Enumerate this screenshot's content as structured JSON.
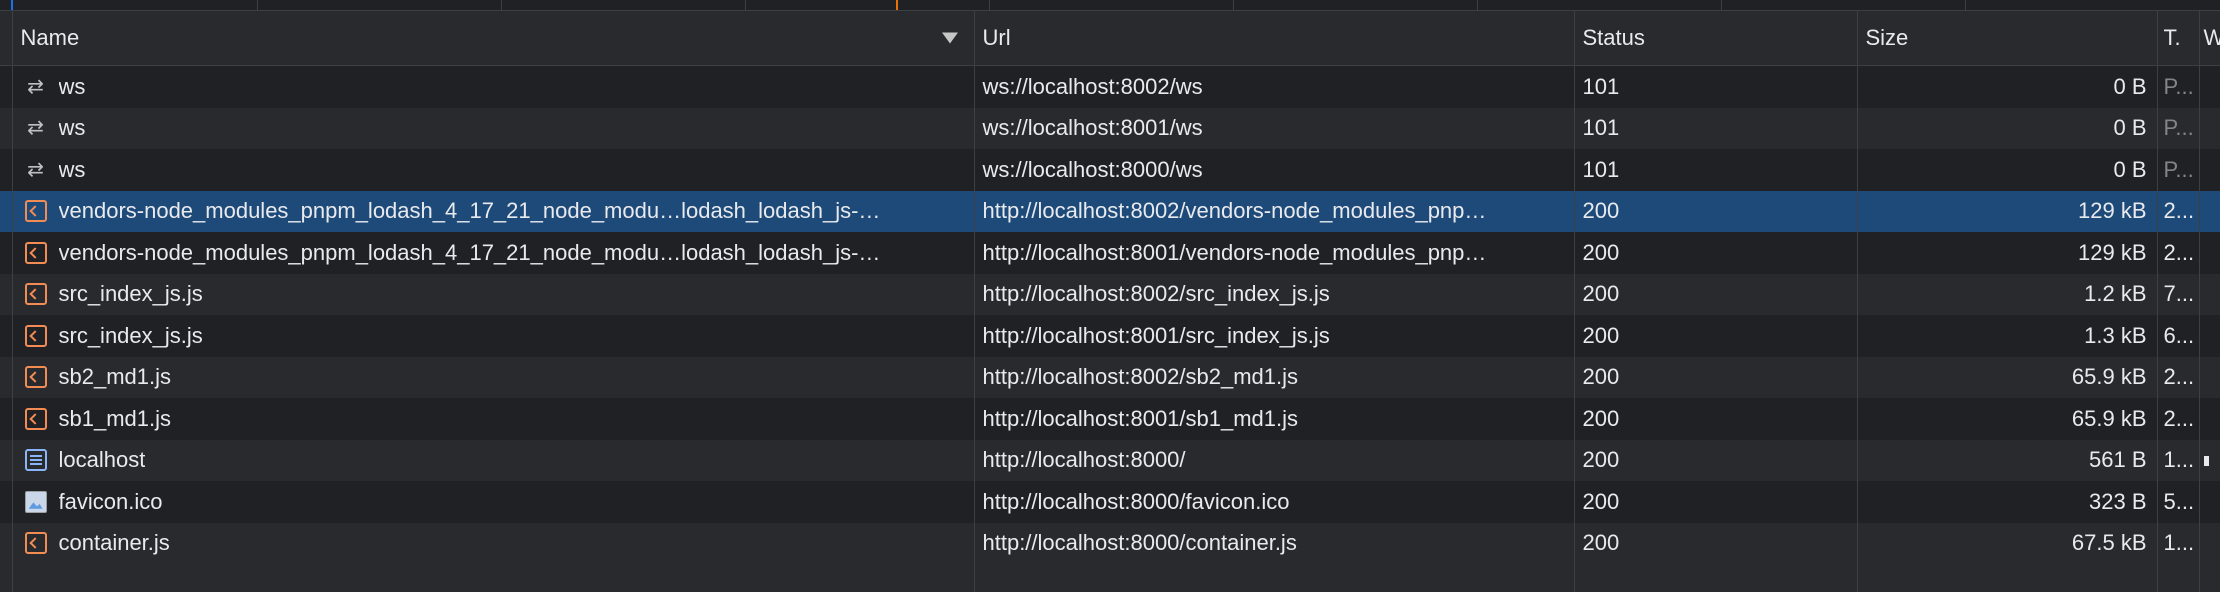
{
  "columns": {
    "name": "Name",
    "url": "Url",
    "status": "Status",
    "size": "Size",
    "type": "T.",
    "waterfall": "W"
  },
  "rows": [
    {
      "icon": "websocket-icon",
      "name": "ws",
      "url": "ws://localhost:8002/ws",
      "status": "101",
      "size": "0 B",
      "type": "P...",
      "type_dim": true
    },
    {
      "icon": "websocket-icon",
      "name": "ws",
      "url": "ws://localhost:8001/ws",
      "status": "101",
      "size": "0 B",
      "type": "P...",
      "type_dim": true
    },
    {
      "icon": "websocket-icon",
      "name": "ws",
      "url": "ws://localhost:8000/ws",
      "status": "101",
      "size": "0 B",
      "type": "P...",
      "type_dim": true
    },
    {
      "icon": "script-icon",
      "name": "vendors-node_modules_pnpm_lodash_4_17_21_node_modu…lodash_lodash_js-…",
      "url": "http://localhost:8002/vendors-node_modules_pnp…",
      "status": "200",
      "size": "129 kB",
      "type": "2...",
      "selected": true
    },
    {
      "icon": "script-icon",
      "name": "vendors-node_modules_pnpm_lodash_4_17_21_node_modu…lodash_lodash_js-…",
      "url": "http://localhost:8001/vendors-node_modules_pnp…",
      "status": "200",
      "size": "129 kB",
      "type": "2..."
    },
    {
      "icon": "script-icon",
      "name": "src_index_js.js",
      "url": "http://localhost:8002/src_index_js.js",
      "status": "200",
      "size": "1.2 kB",
      "type": "7..."
    },
    {
      "icon": "script-icon",
      "name": "src_index_js.js",
      "url": "http://localhost:8001/src_index_js.js",
      "status": "200",
      "size": "1.3 kB",
      "type": "6..."
    },
    {
      "icon": "script-icon",
      "name": "sb2_md1.js",
      "url": "http://localhost:8002/sb2_md1.js",
      "status": "200",
      "size": "65.9 kB",
      "type": "2..."
    },
    {
      "icon": "script-icon",
      "name": "sb1_md1.js",
      "url": "http://localhost:8001/sb1_md1.js",
      "status": "200",
      "size": "65.9 kB",
      "type": "2..."
    },
    {
      "icon": "document-icon",
      "name": "localhost",
      "url": "http://localhost:8000/",
      "status": "200",
      "size": "561 B",
      "type": "1...",
      "waterfall_bar": true
    },
    {
      "icon": "image-icon",
      "name": "favicon.ico",
      "url": "http://localhost:8000/favicon.ico",
      "status": "200",
      "size": "323 B",
      "type": "5..."
    },
    {
      "icon": "script-icon",
      "name": "container.js",
      "url": "http://localhost:8000/container.js",
      "status": "200",
      "size": "67.5 kB",
      "type": "1..."
    }
  ]
}
